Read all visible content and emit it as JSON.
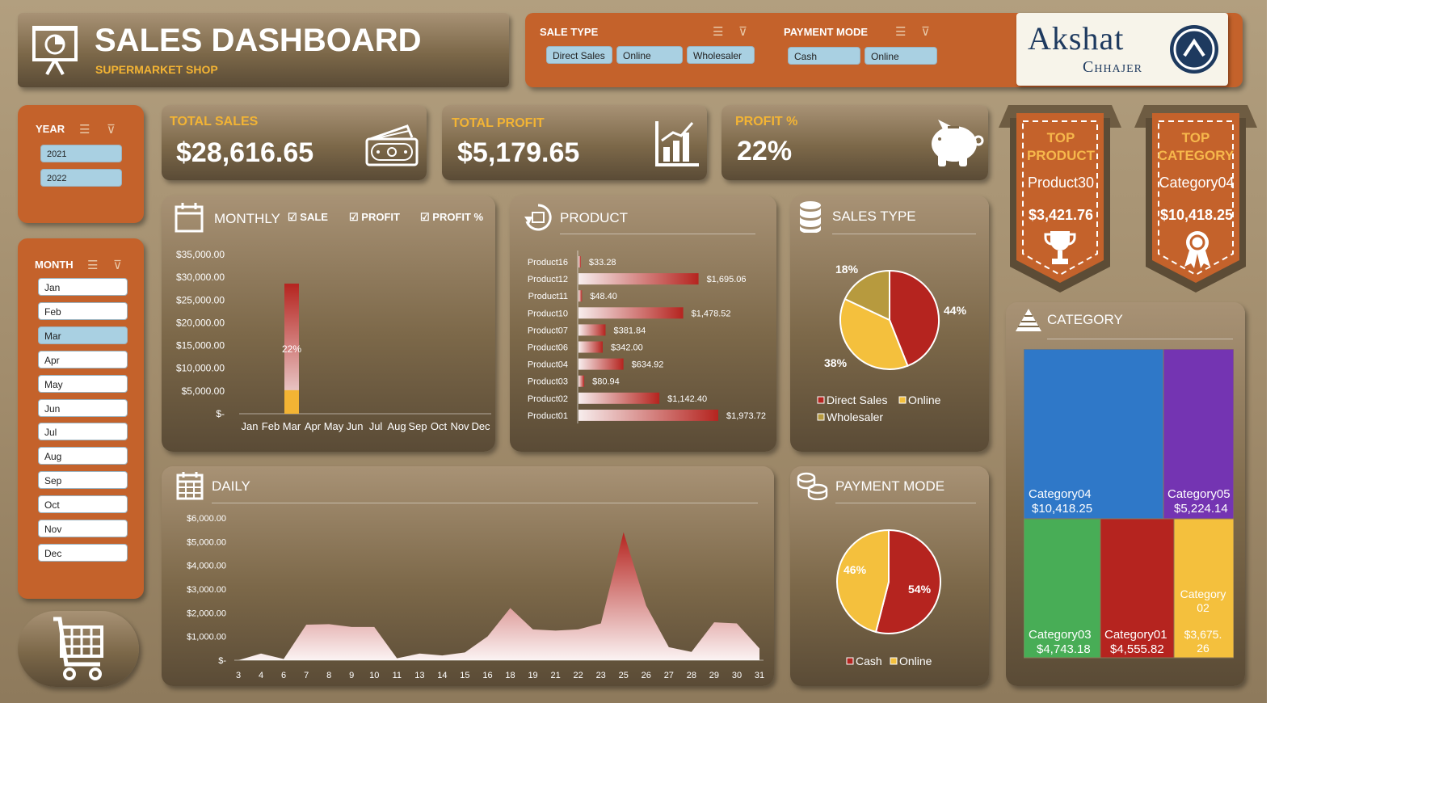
{
  "header": {
    "title": "SALES DASHBOARD",
    "subtitle": "SUPERMARKET SHOP"
  },
  "filters": {
    "sale_type": {
      "label": "SALE TYPE",
      "options": [
        "Direct Sales",
        "Online",
        "Wholesaler"
      ]
    },
    "payment_mode": {
      "label": "PAYMENT MODE",
      "options": [
        "Cash",
        "Online"
      ]
    }
  },
  "logo": {
    "line1": "Akshat",
    "line2": "Chhajer"
  },
  "year": {
    "label": "YEAR",
    "options": [
      "2021",
      "2022"
    ]
  },
  "month": {
    "label": "MONTH",
    "options": [
      "Jan",
      "Feb",
      "Mar",
      "Apr",
      "May",
      "Jun",
      "Jul",
      "Aug",
      "Sep",
      "Oct",
      "Nov",
      "Dec"
    ],
    "selected": "Mar"
  },
  "kpis": {
    "total_sales": {
      "label": "TOTAL SALES",
      "value": "$28,616.65"
    },
    "total_profit": {
      "label": "TOTAL PROFIT",
      "value": "$5,179.65"
    },
    "profit_pct": {
      "label": "PROFIT %",
      "value": "22%"
    }
  },
  "top_product": {
    "label1": "TOP",
    "label2": "PRODUCT",
    "name": "Product30",
    "value": "$3,421.76"
  },
  "top_category": {
    "label1": "TOP",
    "label2": "CATEGORY",
    "name": "Category04",
    "value": "$10,418.25"
  },
  "monthly": {
    "title": "MONTHLY",
    "toggles": [
      "SALE",
      "PROFIT",
      "PROFIT %"
    ],
    "y_ticks": [
      "$35,000.00",
      "$30,000.00",
      "$25,000.00",
      "$20,000.00",
      "$15,000.00",
      "$10,000.00",
      "$5,000.00",
      "$-"
    ],
    "categories": [
      "Jan",
      "Feb",
      "Mar",
      "Apr",
      "May",
      "Jun",
      "Jul",
      "Aug",
      "Sep",
      "Oct",
      "Nov",
      "Dec"
    ],
    "bar_label": "22%"
  },
  "product": {
    "title": "PRODUCT"
  },
  "sales_type": {
    "title": "SALES TYPE",
    "legend": [
      "Direct Sales",
      "Online",
      "Wholesaler"
    ],
    "labels": [
      "44%",
      "38%",
      "18%"
    ]
  },
  "payment_mode": {
    "title": "PAYMENT MODE",
    "legend": [
      "Cash",
      "Online"
    ],
    "labels": [
      "54%",
      "46%"
    ]
  },
  "daily": {
    "title": "DAILY",
    "y_ticks": [
      "$6,000.00",
      "$5,000.00",
      "$4,000.00",
      "$3,000.00",
      "$2,000.00",
      "$1,000.00",
      "$-"
    ]
  },
  "category": {
    "title": "CATEGORY"
  },
  "chart_data": [
    {
      "type": "bar",
      "title": "MONTHLY",
      "categories": [
        "Jan",
        "Feb",
        "Mar",
        "Apr",
        "May",
        "Jun",
        "Jul",
        "Aug",
        "Sep",
        "Oct",
        "Nov",
        "Dec"
      ],
      "series": [
        {
          "name": "SALE",
          "values": [
            0,
            0,
            28616.65,
            0,
            0,
            0,
            0,
            0,
            0,
            0,
            0,
            0
          ]
        },
        {
          "name": "PROFIT",
          "values": [
            0,
            0,
            5179.65,
            0,
            0,
            0,
            0,
            0,
            0,
            0,
            0,
            0
          ]
        }
      ],
      "ylim": [
        0,
        35000
      ]
    },
    {
      "type": "bar",
      "title": "PRODUCT",
      "categories": [
        "Product16",
        "Product12",
        "Product11",
        "Product10",
        "Product07",
        "Product06",
        "Product04",
        "Product03",
        "Product02",
        "Product01"
      ],
      "values": [
        33.28,
        1695.06,
        48.4,
        1478.52,
        381.84,
        342.0,
        634.92,
        80.94,
        1142.4,
        1973.72
      ],
      "labels": [
        "$33.28",
        "$1,695.06",
        "$48.40",
        "$1,478.52",
        "$381.84",
        "$342.00",
        "$634.92",
        "$80.94",
        "$1,142.40",
        "$1,973.72"
      ]
    },
    {
      "type": "pie",
      "title": "SALES TYPE",
      "categories": [
        "Direct Sales",
        "Online",
        "Wholesaler"
      ],
      "values": [
        44,
        38,
        18
      ],
      "colors": [
        "#b5241f",
        "#f4c03d",
        "#b79a3e"
      ]
    },
    {
      "type": "pie",
      "title": "PAYMENT MODE",
      "categories": [
        "Cash",
        "Online"
      ],
      "values": [
        54,
        46
      ],
      "colors": [
        "#b5241f",
        "#f4c03d"
      ]
    },
    {
      "type": "area",
      "title": "DAILY",
      "x": [
        3,
        4,
        6,
        7,
        8,
        9,
        10,
        11,
        13,
        14,
        15,
        16,
        18,
        19,
        21,
        22,
        23,
        25,
        26,
        27,
        28,
        29,
        30,
        31
      ],
      "values": [
        0,
        280,
        50,
        1500,
        1520,
        1400,
        1400,
        80,
        280,
        200,
        330,
        1000,
        2200,
        1300,
        1250,
        1300,
        1550,
        5400,
        2300,
        550,
        350,
        1600,
        1550,
        500
      ],
      "ylim": [
        0,
        6000
      ]
    },
    {
      "type": "treemap",
      "title": "CATEGORY",
      "categories": [
        "Category04",
        "Category05",
        "Category03",
        "Category01",
        "Category02"
      ],
      "values": [
        10418.25,
        5224.14,
        4743.18,
        4555.82,
        3675.26
      ],
      "labels": [
        "$10,418.25",
        "$5,224.14",
        "$4,743.18",
        "$4,555.82",
        "$3,675.26"
      ],
      "colors": [
        "#2f78c8",
        "#7434b2",
        "#48ad56",
        "#b5241f",
        "#f4c03d"
      ]
    }
  ]
}
